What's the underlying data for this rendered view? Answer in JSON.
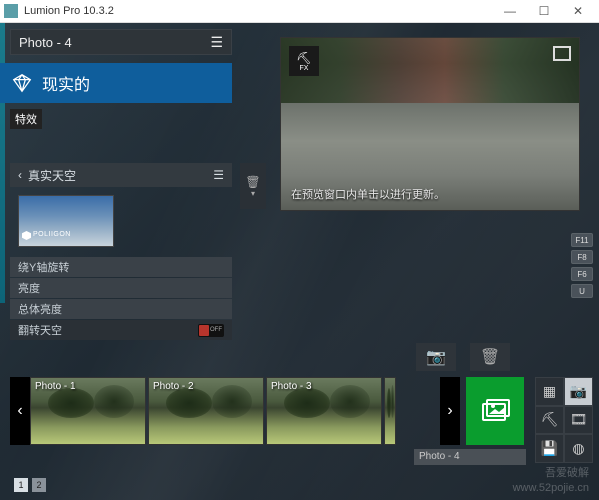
{
  "window": {
    "title": "Lumion Pro 10.3.2"
  },
  "panel": {
    "title": "Photo - 4"
  },
  "style": {
    "label": "现实的"
  },
  "fx_tab": "特效",
  "effect": {
    "name": "真实天空",
    "brand": "POLIIGON",
    "sliders": [
      "绕Y轴旋转",
      "亮度",
      "总体亮度"
    ],
    "toggle_label": "翻转天空",
    "toggle_state": "OFF"
  },
  "preview": {
    "fx_label": "FX",
    "hint": "在预览窗口内单击以进行更新。"
  },
  "key_buttons": [
    "F11",
    "F8",
    "F6",
    "U"
  ],
  "thumbs": [
    {
      "label": "Photo - 1"
    },
    {
      "label": "Photo - 2"
    },
    {
      "label": "Photo - 3"
    }
  ],
  "thumb_caption": "Photo - 4",
  "pager": [
    "1",
    "2"
  ],
  "watermark": {
    "line1": "吾爱破解",
    "line2": "www.52pojie.cn"
  }
}
